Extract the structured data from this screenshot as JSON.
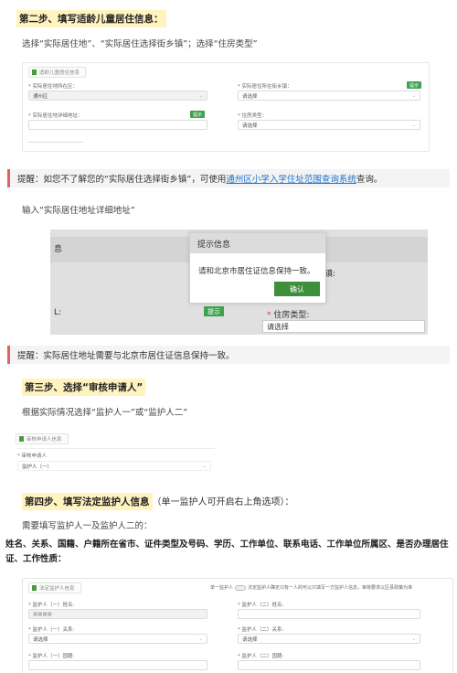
{
  "step2": {
    "title": "第二步、填写适龄儿童居住信息：",
    "instruction": "选择“实际居住地”、“实际居住选择街乡镇”；选择“住房类型”"
  },
  "form1": {
    "tab": "适龄儿童居住信息",
    "residence_label": "实际居住地所在区：",
    "residence_value": "通州区",
    "street_label": "实际居住所在街乡镇：",
    "street_button": "提示",
    "street_placeholder": "请选择",
    "address_label": "实际居住地详细地址：",
    "address_button": "提示",
    "housing_label": "住房类型：",
    "housing_placeholder": "请选择"
  },
  "tip1": {
    "before": "提醒：如您不了解您的“实际居住选择街乡镇”，可使用",
    "link": "通州区小学入学住址范围查询系统",
    "after": "查询。"
  },
  "detail_instruction": "输入“实际居住地址详细地址”",
  "shot": {
    "bg_label_left": "息",
    "bg_label_right": "镇:",
    "bg_label_left2": "L:",
    "bg_tip_button": "提示",
    "housing_label": "住房类型:",
    "housing_placeholder": "请选择",
    "dialog_title": "提示信息",
    "dialog_message": "请和北京市居住证信息保持一致。",
    "dialog_ok": "确认"
  },
  "tip2": "提醒：实际居住地址需要与北京市居住证信息保持一致。",
  "step3": {
    "title": "第三步、选择“审核申请人”",
    "instruction": "根据实际情况选择“监护人一”或“监护人二”"
  },
  "form2": {
    "tab": "审核申请人信息",
    "label": "审核申请人",
    "value": "监护人（一）"
  },
  "step4": {
    "title": "第四步、填写法定监护人信息",
    "title_note": "（单一监护人可开启右上角选项）：",
    "instruction": "需要填写监护人一及监护人二的：",
    "fields": "姓名、关系、国籍、户籍所在省市、证件类型及号码、学历、工作单位、联系电话、工作单位所属区、是否办理居住证、工作性质："
  },
  "form3": {
    "tab": "法定监护人信息",
    "single_label": "单一监护人",
    "single_note": "法定监护人确定只有一人的可以只填写一方监护人信息，审核要求以区县政策为准",
    "g1_name_label": "监护人（一）姓名:",
    "g1_name_value": "■■■■",
    "g2_name_label": "监护人（二）姓名:",
    "g1_rel_label": "监护人（一）关系:",
    "g1_rel_value": "请选择",
    "g2_rel_label": "监护人（二）关系:",
    "g2_rel_value": "请选择",
    "g1_nat_label": "监护人（一）国籍:",
    "g2_nat_label": "监护人（二）国籍:"
  }
}
